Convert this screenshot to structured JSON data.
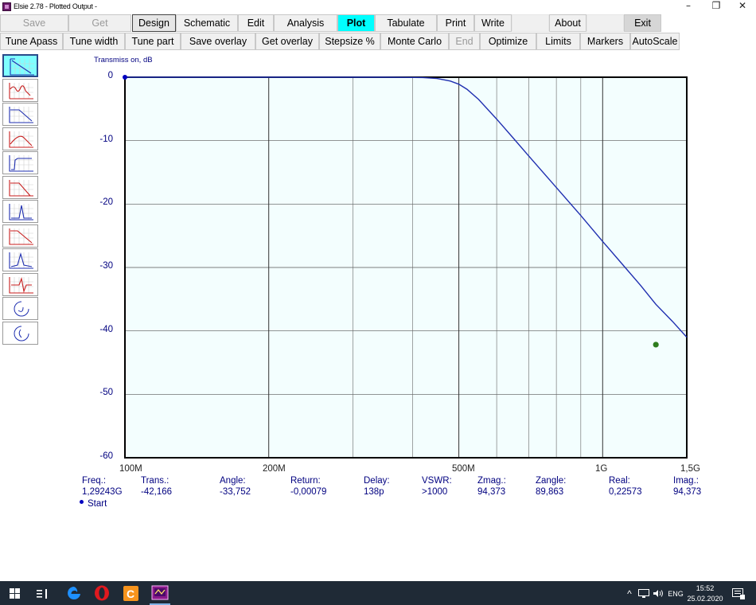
{
  "window": {
    "title": "Elsie 2.78 - Plotted Output -",
    "minimize_glyph": "–",
    "restore_glyph": "❐",
    "close_glyph": "✕"
  },
  "toolbar1": [
    {
      "label": "Save",
      "state": "disabled"
    },
    {
      "label": "Get",
      "state": "disabled"
    },
    {
      "label": "Design",
      "state": "sunken"
    },
    {
      "label": "Schematic",
      "state": "normal"
    },
    {
      "label": "Edit",
      "state": "normal"
    },
    {
      "label": "Analysis",
      "state": "normal"
    },
    {
      "label": "Plot",
      "state": "active"
    },
    {
      "label": "Tabulate",
      "state": "normal"
    },
    {
      "label": "Print",
      "state": "normal"
    },
    {
      "label": "Write",
      "state": "normal"
    },
    {
      "label": "",
      "state": "gap"
    },
    {
      "label": "About",
      "state": "normal"
    },
    {
      "label": "",
      "state": "gap"
    },
    {
      "label": "Exit",
      "state": "gray"
    }
  ],
  "toolbar2": [
    {
      "label": "Tune Apass",
      "state": "normal"
    },
    {
      "label": "Tune width",
      "state": "normal"
    },
    {
      "label": "Tune part",
      "state": "normal"
    },
    {
      "label": "Save overlay",
      "state": "normal"
    },
    {
      "label": "Get overlay",
      "state": "normal"
    },
    {
      "label": "Stepsize %",
      "state": "normal"
    },
    {
      "label": "Monte Carlo",
      "state": "normal"
    },
    {
      "label": "End",
      "state": "disabled"
    },
    {
      "label": "Optimize",
      "state": "normal"
    },
    {
      "label": "Limits",
      "state": "normal"
    },
    {
      "label": "Markers",
      "state": "normal"
    },
    {
      "label": "AutoScale",
      "state": "normal"
    }
  ],
  "plot_type_icons": [
    "transmission-plot-icon",
    "passband-ripple-plot-icon",
    "transmission-reflection-plot-icon",
    "transmission-delay-plot-icon",
    "step-response-plot-icon",
    "transmission-return-loss-plot-icon",
    "impulse-response-plot-icon",
    "transmission-overlay-plot-icon",
    "group-delay-plot-icon",
    "phase-plot-icon",
    "smith-chart-input-icon",
    "smith-chart-output-icon"
  ],
  "colors": {
    "plot_background": "#f3fefe",
    "trace": "#1f2fb0",
    "marker_end": "#2e7d1e",
    "marker_start": "#0000c0",
    "label_navy": "#000080",
    "active_button": "#00ffff"
  },
  "chart_data": {
    "type": "line",
    "ylabel": "Transmiss on, dB",
    "x_scale": "log",
    "xlim": [
      100,
      1500
    ],
    "ylim": [
      -60,
      0
    ],
    "y_ticks": [
      "0",
      "-10",
      "-20",
      "-30",
      "-40",
      "-50",
      "-60"
    ],
    "x_tick_labels": [
      "100M",
      "200M",
      "500M",
      "1G",
      "1,5G"
    ],
    "grid_x_mhz": [
      200,
      300,
      400,
      500,
      600,
      700,
      800,
      900,
      1000
    ],
    "grid_major_x_mhz": [
      200,
      500,
      1000
    ],
    "series": [
      {
        "x_mhz": [
          100,
          200,
          300,
          350,
          420,
          450,
          480,
          500,
          520,
          550,
          600,
          650,
          700,
          800,
          900,
          1000,
          1100,
          1200,
          1292,
          1400,
          1500
        ],
        "y_db": [
          0,
          0,
          0,
          0,
          -0.05,
          -0.2,
          -0.6,
          -1.1,
          -1.9,
          -3.5,
          -6.6,
          -9.6,
          -12.4,
          -17.4,
          -21.8,
          -25.9,
          -29.5,
          -32.8,
          -35.8,
          -38.5,
          -41.0
        ]
      }
    ],
    "markers": [
      {
        "x_mhz": 100,
        "y_db": 0,
        "role": "start"
      },
      {
        "x_mhz": 1292.43,
        "y_db": -42.166,
        "role": "readout"
      }
    ]
  },
  "readout": {
    "headers": [
      "Freq.:",
      "Trans.:",
      "Angle:",
      "Return:",
      "Delay:",
      "VSWR:",
      "Zmag.:",
      "Zangle:",
      "Real:",
      "Imag.:"
    ],
    "values": [
      "1,29243G",
      "-42,166",
      "-33,752",
      "-0,00079",
      "138p",
      ">1000",
      "94,373",
      "89,863",
      "0,22573",
      "94,373"
    ],
    "legend_label": "Start"
  },
  "taskbar": {
    "apps": [
      "windows-start-icon",
      "task-view-icon",
      "edge-browser-icon",
      "opera-browser-icon",
      "file-manager-icon",
      "elsie-app-icon"
    ],
    "tray": {
      "chevron": "^",
      "language": "ENG",
      "time": "15:52",
      "date": "25.02.2020"
    }
  }
}
